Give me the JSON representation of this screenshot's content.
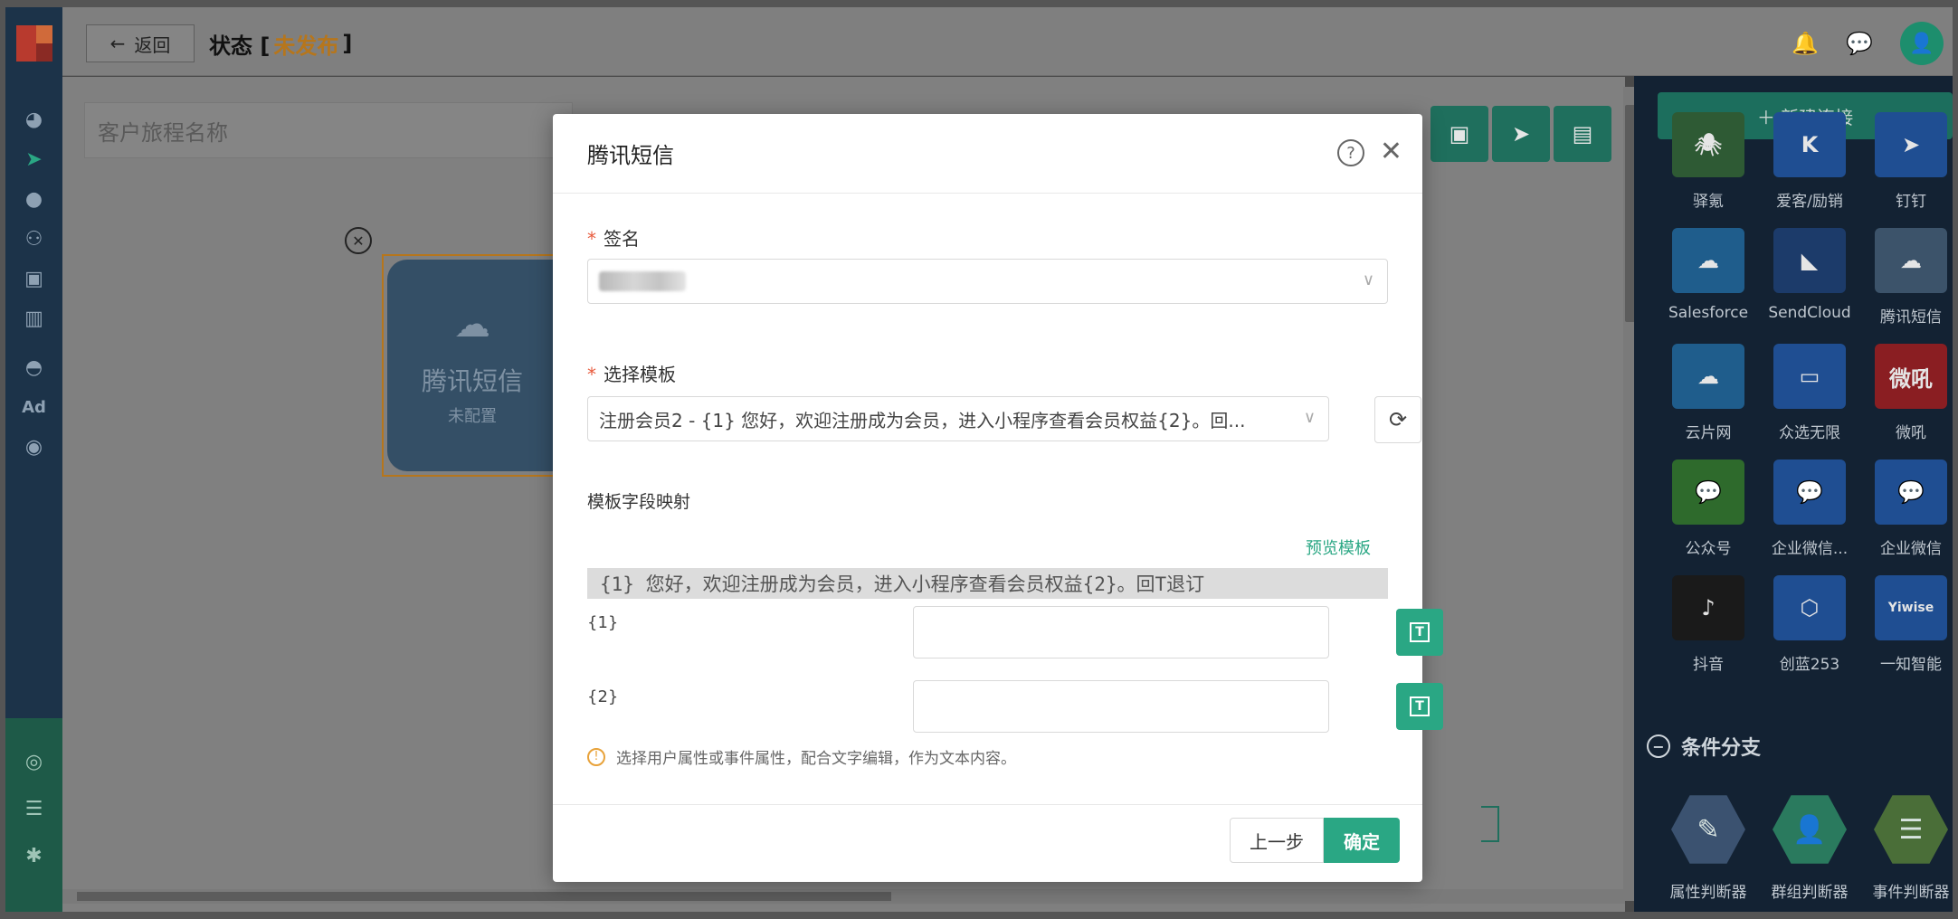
{
  "topbar": {
    "back_arrow": "←",
    "back_label": "返回",
    "status_prefix": "状态 [",
    "status_value": "未发布",
    "status_suffix": "]",
    "bell_icon": "🔔",
    "chat_icon": "💬",
    "avatar_icon": "👤"
  },
  "rail": {
    "icons": [
      "dashboard-icon",
      "send-icon",
      "user-icon",
      "users-icon",
      "bookmark-icon",
      "chart-icon",
      "wechat-icon",
      "ad-icon",
      "circle-icon",
      "target-icon",
      "list-icon",
      "gear-icon"
    ],
    "ad_label": "Ad"
  },
  "canvas": {
    "journey_placeholder": "客户旅程名称",
    "node": {
      "close": "✕",
      "icon": "☁",
      "title": "腾讯短信",
      "subtitle": "未配置"
    },
    "tools": [
      "save-icon",
      "send-icon",
      "layout-icon"
    ],
    "zoom_controls": [
      "locate-icon",
      "zoom-in-icon",
      "zoom-out-icon",
      "fit-icon"
    ]
  },
  "palette": {
    "new_connection": "＋ 新建连接",
    "tiles": [
      {
        "label": "驿氪",
        "icon": "🕷",
        "color": "#2e5a34"
      },
      {
        "label": "爱客/励销",
        "icon": "K",
        "color": "#1f4e92"
      },
      {
        "label": "钉钉",
        "icon": "➤",
        "color": "#1f4e92"
      },
      {
        "label": "Salesforce",
        "icon": "☁",
        "color": "#1f5d8c"
      },
      {
        "label": "SendCloud",
        "icon": "◣",
        "color": "#1c3b6a"
      },
      {
        "label": "腾讯短信",
        "icon": "☁",
        "color": "#3c536a"
      },
      {
        "label": "云片网",
        "icon": "☁",
        "color": "#1f5d8c"
      },
      {
        "label": "众选无限",
        "icon": "▭",
        "color": "#1f4e92"
      },
      {
        "label": "微吼",
        "icon": "微吼",
        "color": "#8a1e22"
      },
      {
        "label": "公众号",
        "icon": "💬",
        "color": "#2e6a2c"
      },
      {
        "label": "企业微信...",
        "icon": "💬",
        "color": "#1f4e92"
      },
      {
        "label": "企业微信",
        "icon": "💬",
        "color": "#1f4e92"
      },
      {
        "label": "抖音",
        "icon": "♪",
        "color": "#1a1a1a"
      },
      {
        "label": "创蓝253",
        "icon": "⬡",
        "color": "#1f4e92"
      },
      {
        "label": "一知智能",
        "icon": "Yiwise",
        "color": "#1f4e92"
      }
    ],
    "section_title": "条件分支",
    "section_icon": "−",
    "branches": [
      {
        "label": "属性判断器",
        "icon": "✎",
        "color": "#3b5270"
      },
      {
        "label": "群组判断器",
        "icon": "👤",
        "color": "#2a7a5e"
      },
      {
        "label": "事件判断器",
        "icon": "☰",
        "color": "#4a6e38"
      }
    ]
  },
  "modal": {
    "title": "腾讯短信",
    "help_icon": "?",
    "close_icon": "✕",
    "signature_label": "签名",
    "required_mark": "*",
    "template_label": "选择模板",
    "template_value": "注册会员2 - {1} 您好，欢迎注册成为会员，进入小程序查看会员权益{2}。回...",
    "chevron": "∨",
    "refresh_icon": "⟳",
    "mapping_label": "模板字段映射",
    "preview_link": "预览模板",
    "template_text": "{1} 您好，欢迎注册成为会员，进入小程序查看会员权益{2}。回T退订",
    "fields": [
      {
        "name": "{1}",
        "value": ""
      },
      {
        "name": "{2}",
        "value": ""
      }
    ],
    "text_btn_icon": "T",
    "hint_icon": "!",
    "hint": "选择用户属性或事件属性，配合文字编辑，作为文本内容。",
    "prev_label": "上一步",
    "ok_label": "确定"
  }
}
